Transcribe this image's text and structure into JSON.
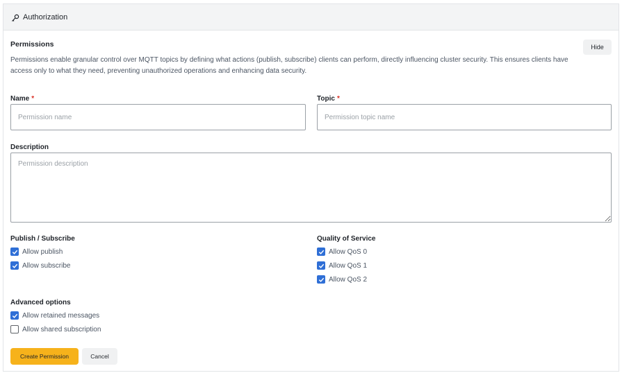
{
  "header": {
    "icon": "key-icon",
    "title": "Authorization"
  },
  "permissions": {
    "title": "Permissions",
    "description": "Permissions enable granular control over MQTT topics by defining what actions (publish, subscribe) clients can perform, directly influencing cluster security. This ensures clients have access only to what they need, preventing unauthorized operations and enhancing data security.",
    "hide_label": "Hide"
  },
  "form": {
    "name": {
      "label": "Name",
      "required_mark": "*",
      "placeholder": "Permission name",
      "value": ""
    },
    "topic": {
      "label": "Topic",
      "required_mark": "*",
      "placeholder": "Permission topic name",
      "value": ""
    },
    "description": {
      "label": "Description",
      "placeholder": "Permission description",
      "value": ""
    }
  },
  "publish_subscribe": {
    "title": "Publish / Subscribe",
    "options": [
      {
        "label": "Allow publish",
        "checked": true
      },
      {
        "label": "Allow subscribe",
        "checked": true
      }
    ]
  },
  "qos": {
    "title": "Quality of Service",
    "options": [
      {
        "label": "Allow QoS 0",
        "checked": true
      },
      {
        "label": "Allow QoS 1",
        "checked": true
      },
      {
        "label": "Allow QoS 2",
        "checked": true
      }
    ]
  },
  "advanced": {
    "title": "Advanced options",
    "options": [
      {
        "label": "Allow retained messages",
        "checked": true
      },
      {
        "label": "Allow shared subscription",
        "checked": false
      }
    ]
  },
  "actions": {
    "create_label": "Create Permission",
    "cancel_label": "Cancel"
  },
  "colors": {
    "accent": "#f6b21b",
    "checkbox": "#2f6fd6",
    "required": "#d93025"
  }
}
